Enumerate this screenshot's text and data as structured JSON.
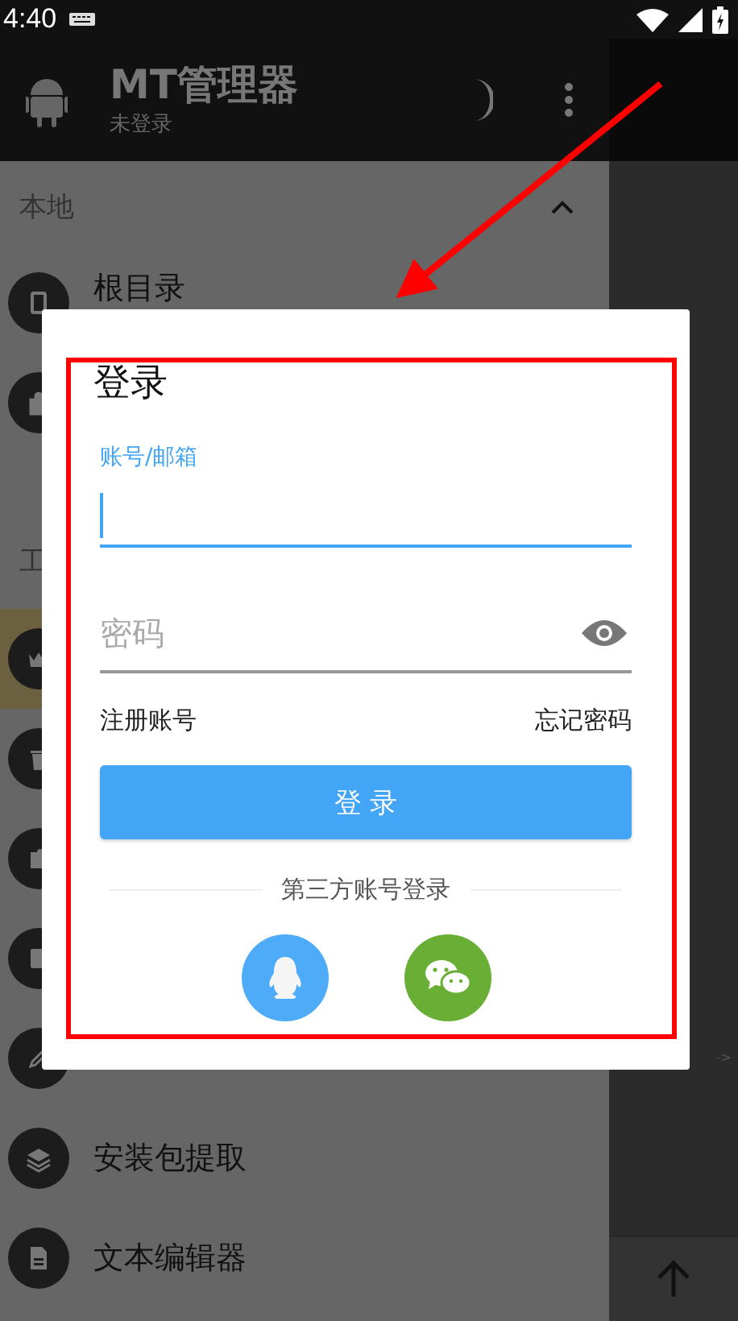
{
  "status_bar": {
    "time": "4:40"
  },
  "app_bar": {
    "title": "MT管理器",
    "subtitle": "未登录"
  },
  "drawer": {
    "sections": [
      {
        "title": "本地",
        "expanded": true,
        "items": [
          {
            "label": "根目录",
            "kind": "device",
            "selected": false
          },
          {
            "kind": "bag",
            "selected": false
          }
        ]
      },
      {
        "title": "工",
        "items": [
          {
            "kind": "crown",
            "selected": true
          },
          {
            "kind": "trash",
            "selected": false
          },
          {
            "kind": "puzzle",
            "selected": false
          },
          {
            "kind": "square",
            "selected": false
          },
          {
            "kind": "pen",
            "selected": false
          },
          {
            "label": "安装包提取",
            "kind": "layers",
            "selected": false
          },
          {
            "label": "文本编辑器",
            "kind": "file",
            "selected": false
          }
        ]
      }
    ]
  },
  "side_panel": {
    "text": "->"
  },
  "dialog": {
    "title": "登录",
    "account_field": {
      "label": "账号/邮箱",
      "focused": true
    },
    "password_field": {
      "placeholder": "密码"
    },
    "links": [
      "注册账号",
      "忘记密码"
    ],
    "login_button": "登 录",
    "third_party": {
      "caption": "第三方账号登录",
      "providers": [
        {
          "kind": "qq",
          "color": "#4dabf7"
        },
        {
          "kind": "wechat",
          "color": "#6aaf35"
        }
      ]
    }
  }
}
